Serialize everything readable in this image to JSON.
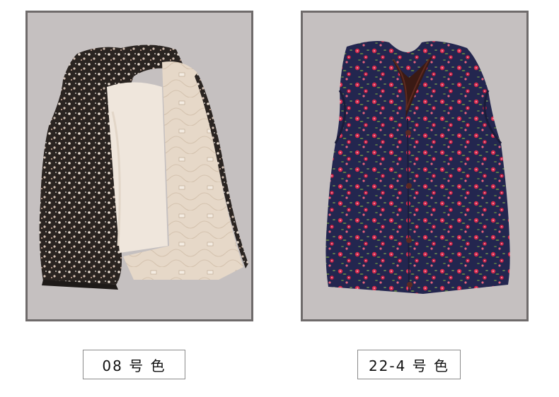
{
  "products": [
    {
      "code_label": "08 号 色",
      "image": "floral-vest-open-fleece-lining-photo",
      "colors": {
        "background": "#c5c0c0",
        "fabric": "#2b2523",
        "lining": "#efe6dc"
      }
    },
    {
      "code_label": "22-4 号 色",
      "image": "navy-floral-vest-buttoned-photo",
      "colors": {
        "background": "#c5c0c0",
        "fabric": "#23264f",
        "flower": "#d5294a"
      }
    }
  ]
}
